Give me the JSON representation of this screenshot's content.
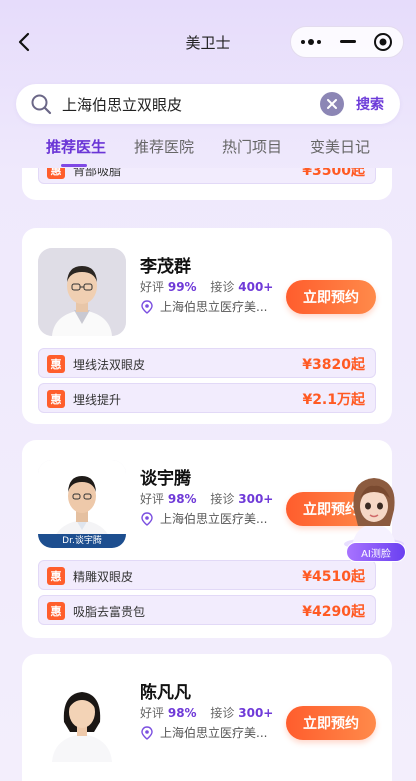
{
  "header": {
    "title": "美卫士"
  },
  "search": {
    "query": "上海伯思立双眼皮",
    "button_label": "搜索"
  },
  "tabs": [
    {
      "label": "推荐医生"
    },
    {
      "label": "推荐医院"
    },
    {
      "label": "热门项目"
    },
    {
      "label": "变美日记"
    }
  ],
  "partial_card": {
    "service": {
      "badge": "惠",
      "name": "背部吸脂",
      "price": "¥3500起"
    }
  },
  "doctors": [
    {
      "name": "李茂群",
      "rating_label": "好评",
      "rating": "99%",
      "consult_label": "接诊",
      "consults": "400+",
      "hospital": "上海伯思立医疗美...",
      "book_label": "立即预约",
      "services": [
        {
          "badge": "惠",
          "name": "埋线法双眼皮",
          "price": "¥3820起"
        },
        {
          "badge": "惠",
          "name": "埋线提升",
          "price": "¥2.1万起"
        }
      ]
    },
    {
      "name": "谈宇腾",
      "rating_label": "好评",
      "rating": "98%",
      "consult_label": "接诊",
      "consults": "300+",
      "hospital": "上海伯思立医疗美...",
      "book_label": "立即预约",
      "avatar_caption": "Dr.谈宇腾",
      "services": [
        {
          "badge": "惠",
          "name": "精雕双眼皮",
          "price": "¥4510起"
        },
        {
          "badge": "惠",
          "name": "吸脂去富贵包",
          "price": "¥4290起"
        }
      ]
    },
    {
      "name": "陈凡凡",
      "rating_label": "好评",
      "rating": "98%",
      "consult_label": "接诊",
      "consults": "300+",
      "hospital": "上海伯思立医疗美...",
      "book_label": "立即预约"
    }
  ],
  "ai_assistant": {
    "label": "AI测脸"
  },
  "colors": {
    "accent_purple": "#6a35d6",
    "price_orange": "#ff5a23",
    "button_orange": "#ff6a33"
  }
}
